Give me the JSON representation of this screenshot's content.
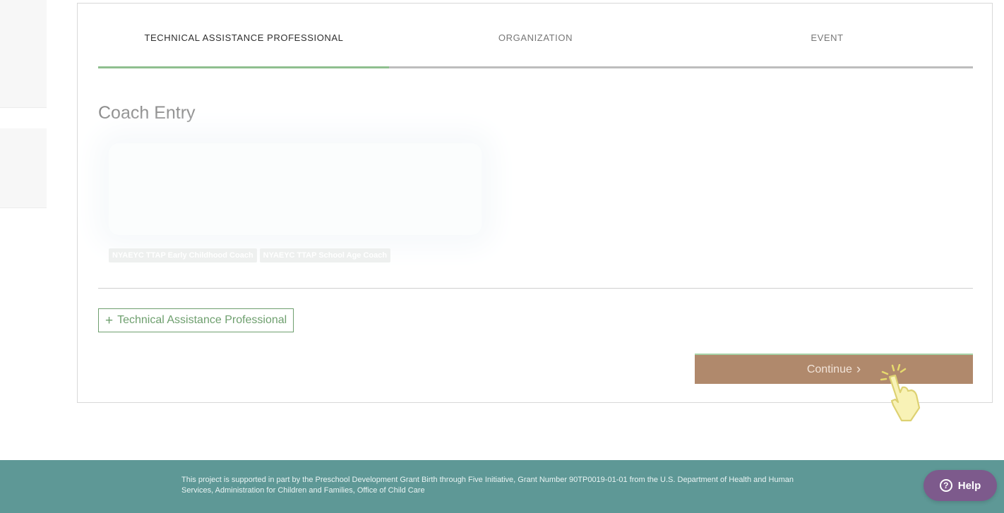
{
  "wizard": {
    "steps": [
      {
        "label": "TECHNICAL ASSISTANCE PROFESSIONAL",
        "active": true
      },
      {
        "label": "ORGANIZATION",
        "active": false
      },
      {
        "label": "EVENT",
        "active": false
      }
    ]
  },
  "main": {
    "title": "Coach Entry",
    "tags": [
      "NYAEYC TTAP Early Childhood Coach",
      "NYAEYC TTAP School Age Coach"
    ],
    "add_button": {
      "icon": "plus-icon",
      "label": "Technical Assistance Professional"
    },
    "continue_button": {
      "label": "Continue",
      "icon": "chevron-right-icon"
    }
  },
  "footer": {
    "text": "This project is supported in part by the Preschool Development Grant Birth through Five Initiative, Grant Number 90TP0019-01-01 from the U.S. Department of Health and Human Services, Administration for Children and Families, Office of Child Care"
  },
  "help": {
    "label": "Help",
    "icon": "question-circle-icon"
  },
  "colors": {
    "accent_green": "#8fbf8f",
    "continue_bg": "#b0896c",
    "footer_bg": "#5e9896",
    "help_bg": "#7d5a8c"
  }
}
